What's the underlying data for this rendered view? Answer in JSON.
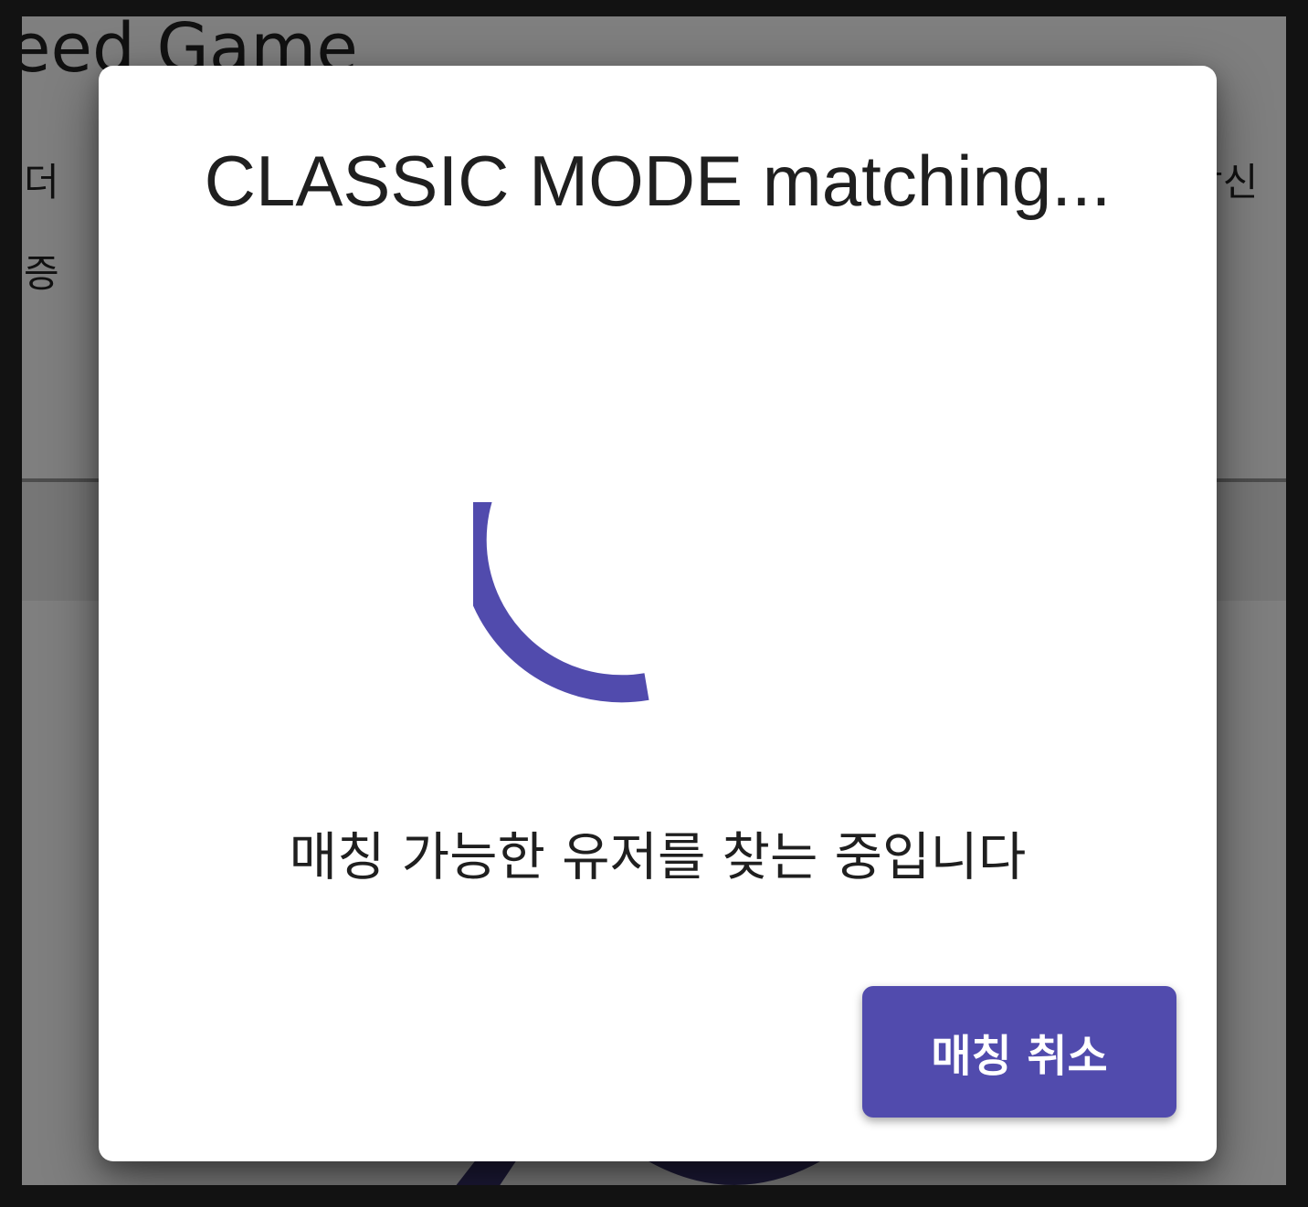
{
  "background": {
    "title_fragment": "eed Game",
    "line1_left_fragment": "더",
    "line1_right_fragment": "당신",
    "line2_left_fragment": "증"
  },
  "dialog": {
    "title": "CLASSIC MODE matching...",
    "status_text": "매칭 가능한 유저를 찾는 중입니다",
    "cancel_label": "매칭 취소"
  },
  "colors": {
    "accent": "#514bad",
    "backdrop": "rgba(0,0,0,0.5)",
    "dialog_bg": "#ffffff"
  },
  "icons": {
    "spinner": "loading-spinner-icon"
  }
}
